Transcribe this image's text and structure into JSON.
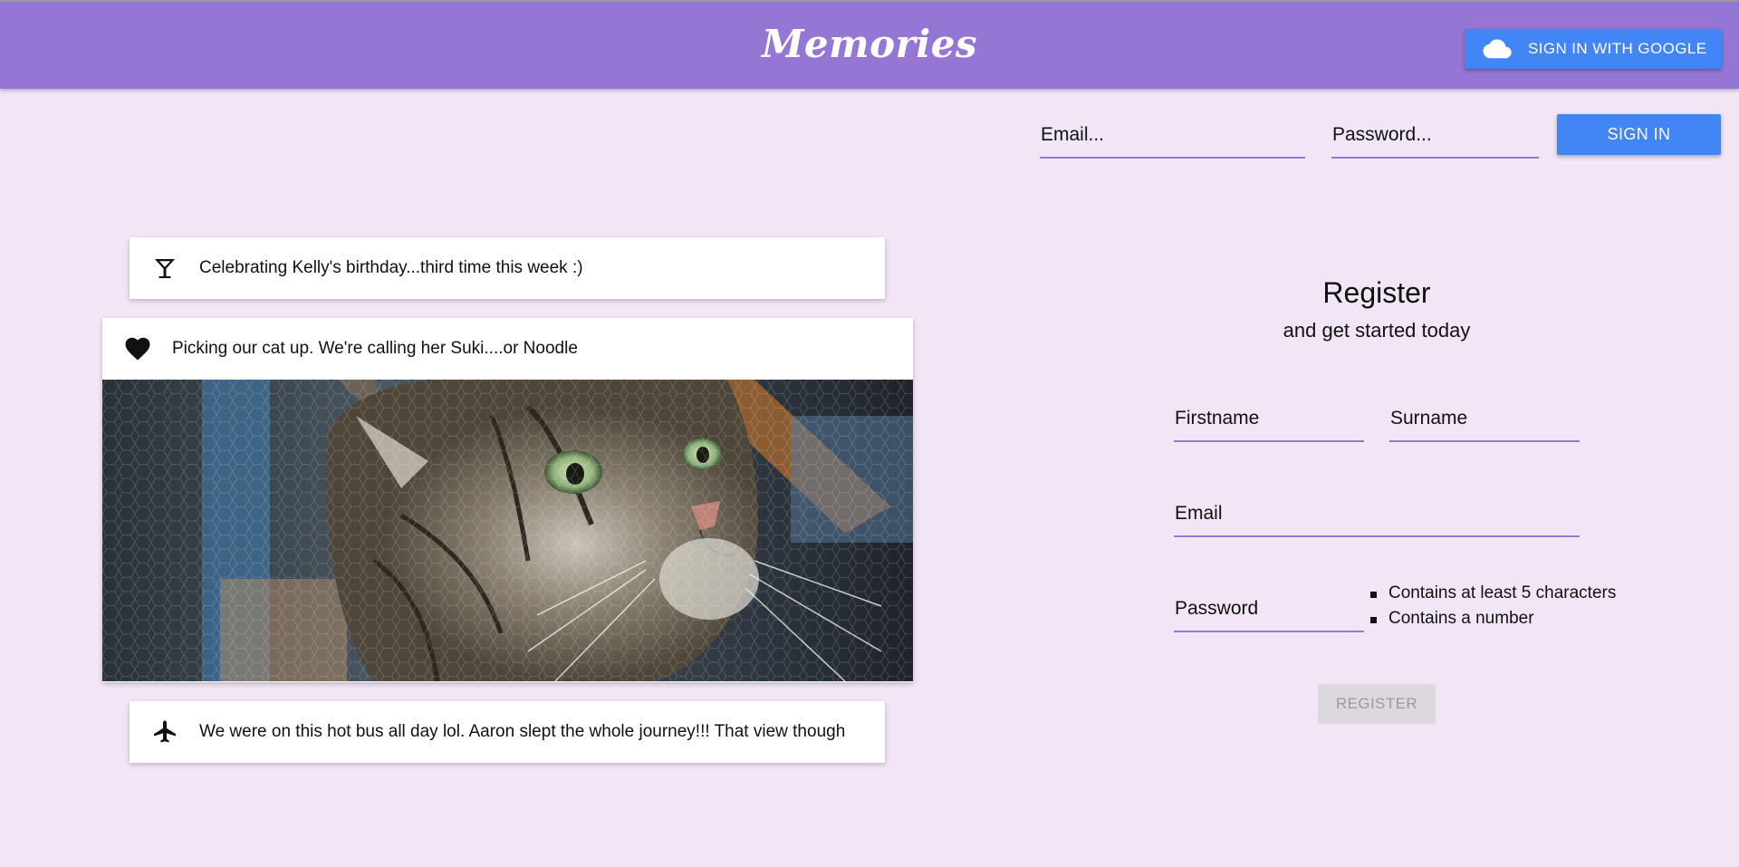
{
  "header": {
    "title": "Memories",
    "google_button": "SIGN IN WITH GOOGLE",
    "google_icon": "cloud-icon"
  },
  "login": {
    "email_placeholder": "Email...",
    "password_placeholder": "Password...",
    "sign_in_label": "SIGN IN"
  },
  "feed": [
    {
      "icon": "martini-icon",
      "text": "Celebrating Kelly's birthday...third time this week :)"
    },
    {
      "icon": "heart-icon",
      "text": "Picking our cat up. We're calling her Suki....or Noodle",
      "has_image": true
    },
    {
      "icon": "airplane-icon",
      "text": "We were on this hot bus all day lol. Aaron slept the whole journey!!! That view though"
    }
  ],
  "register": {
    "title": "Register",
    "subtitle": "and get started today",
    "firstname_placeholder": "Firstname",
    "surname_placeholder": "Surname",
    "email_placeholder": "Email",
    "password_placeholder": "Password",
    "rules": [
      "Contains at least 5 characters",
      "Contains a number"
    ],
    "button_label": "REGISTER"
  },
  "colors": {
    "background": "#f1e5f6",
    "appbar": "#9676d5",
    "primary_button": "#4285f4",
    "input_underline": "#9676d5"
  }
}
